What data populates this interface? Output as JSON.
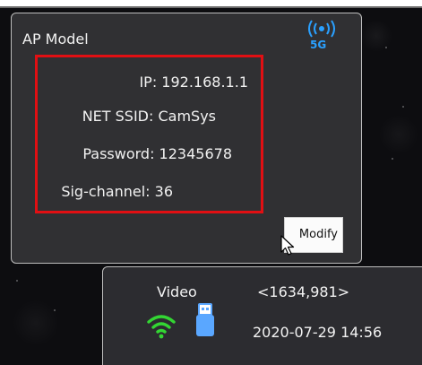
{
  "ap_panel": {
    "title": "AP Model",
    "band": "5G",
    "signal_icon": "wireless-broadcast-icon",
    "ip": "IP: 192.168.1.1",
    "ssid": "NET SSID: CamSys",
    "password": "Password: 12345678",
    "channel": "Sig-channel: 36",
    "modify_label": "Modify",
    "cursor_icon": "mouse-pointer-icon",
    "highlight_color": "#e10f13",
    "accent_color": "#2aa0ff"
  },
  "status_panel": {
    "mode": "Video",
    "coordinates": "<1634,981>",
    "datetime": "2020-07-29 14:56",
    "wifi_icon": "wifi-icon",
    "usb_icon": "usb-drive-icon",
    "wifi_color": "#33d633",
    "usb_color": "#5aa7ff"
  }
}
